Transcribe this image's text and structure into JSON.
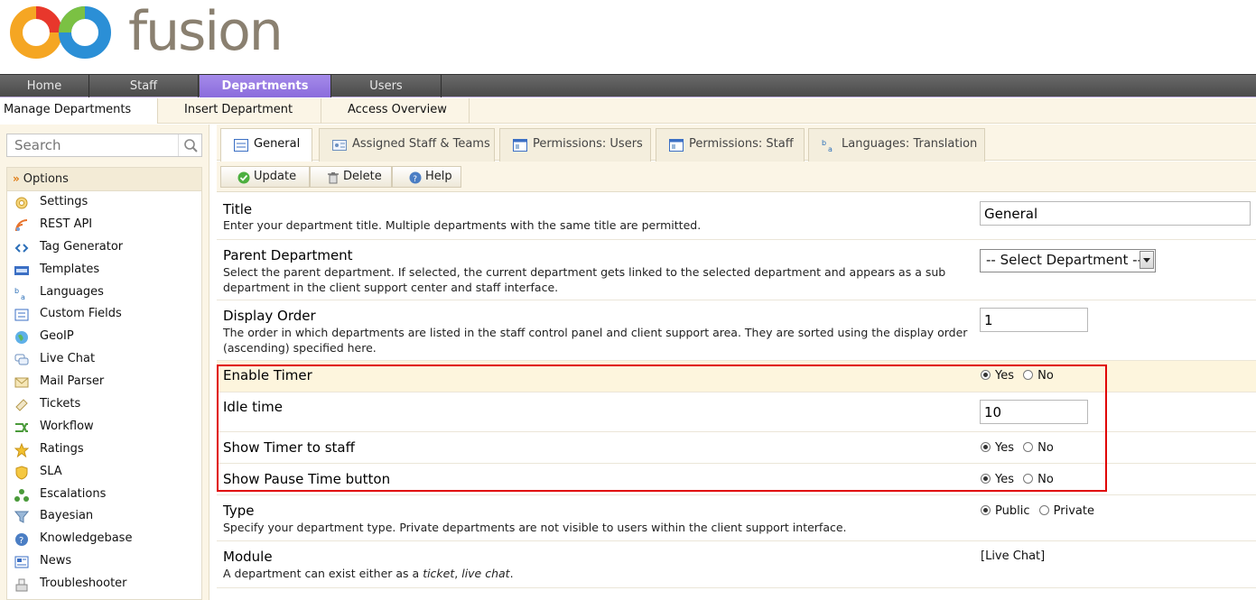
{
  "brand": {
    "name": "fusion"
  },
  "main_nav": [
    {
      "label": "Home",
      "active": false
    },
    {
      "label": "Staff",
      "active": false
    },
    {
      "label": "Departments",
      "active": true
    },
    {
      "label": "Users",
      "active": false
    }
  ],
  "sub_nav": [
    {
      "label": "Manage Departments",
      "active": true
    },
    {
      "label": "Insert Department",
      "active": false
    },
    {
      "label": "Access Overview",
      "active": false
    }
  ],
  "sidebar": {
    "search_placeholder": "Search",
    "options_title": "Options",
    "items": [
      {
        "label": "Settings",
        "icon": "gear-icon"
      },
      {
        "label": "REST API",
        "icon": "rss-icon"
      },
      {
        "label": "Tag Generator",
        "icon": "code-icon"
      },
      {
        "label": "Templates",
        "icon": "html-icon"
      },
      {
        "label": "Languages",
        "icon": "translate-icon"
      },
      {
        "label": "Custom Fields",
        "icon": "form-icon"
      },
      {
        "label": "GeoIP",
        "icon": "globe-icon"
      },
      {
        "label": "Live Chat",
        "icon": "chat-icon"
      },
      {
        "label": "Mail Parser",
        "icon": "mail-icon"
      },
      {
        "label": "Tickets",
        "icon": "ticket-icon"
      },
      {
        "label": "Workflow",
        "icon": "workflow-icon"
      },
      {
        "label": "Ratings",
        "icon": "star-icon"
      },
      {
        "label": "SLA",
        "icon": "shield-icon"
      },
      {
        "label": "Escalations",
        "icon": "escalation-icon"
      },
      {
        "label": "Bayesian",
        "icon": "filter-icon"
      },
      {
        "label": "Knowledgebase",
        "icon": "help-icon"
      },
      {
        "label": "News",
        "icon": "news-icon"
      },
      {
        "label": "Troubleshooter",
        "icon": "troubleshooter-icon"
      }
    ]
  },
  "tabs": [
    {
      "label": "General",
      "active": true
    },
    {
      "label": "Assigned Staff & Teams",
      "active": false
    },
    {
      "label": "Permissions: Users",
      "active": false
    },
    {
      "label": "Permissions: Staff",
      "active": false
    },
    {
      "label": "Languages: Translation",
      "active": false
    }
  ],
  "toolbar": {
    "update": "Update",
    "delete": "Delete",
    "help": "Help"
  },
  "form": {
    "title": {
      "label": "Title",
      "desc": "Enter your department title. Multiple departments with the same title are permitted.",
      "value": "General"
    },
    "parent": {
      "label": "Parent Department",
      "desc": "Select the parent department. If selected, the current department gets linked to the selected department and appears as a sub department in the client support center and staff interface.",
      "value": "-- Select Department --"
    },
    "display_order": {
      "label": "Display Order",
      "desc": "The order in which departments are listed in the staff control panel and client support area. They are sorted using the display order (ascending) specified here.",
      "value": "1"
    },
    "enable_timer": {
      "label": "Enable Timer",
      "yes": "Yes",
      "no": "No",
      "selected": "Yes"
    },
    "idle_time": {
      "label": "Idle time",
      "value": "10"
    },
    "show_timer": {
      "label": "Show Timer to staff",
      "yes": "Yes",
      "no": "No",
      "selected": "Yes"
    },
    "show_pause": {
      "label": "Show Pause Time button",
      "yes": "Yes",
      "no": "No",
      "selected": "Yes"
    },
    "type": {
      "label": "Type",
      "desc": "Specify your department type. Private departments are not visible to users within the client support interface.",
      "public": "Public",
      "private": "Private",
      "selected": "Public"
    },
    "module": {
      "label": "Module",
      "desc_prefix": "A department can exist either as a ",
      "desc_ticket": "ticket",
      "desc_sep": ", ",
      "desc_chat": "live chat",
      "desc_suffix": ".",
      "value": "[Live Chat]"
    }
  },
  "colors": {
    "nav_active": "#9a7ae6",
    "highlight": "#e00000",
    "accent": "#e07b12"
  }
}
